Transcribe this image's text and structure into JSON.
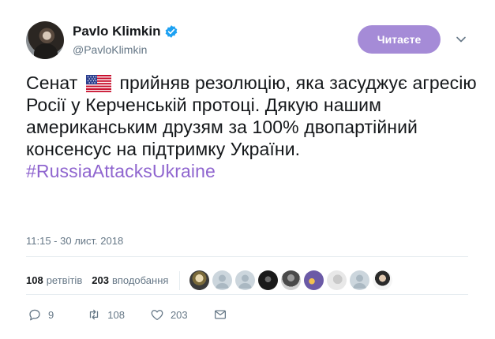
{
  "author": {
    "name": "Pavlo Klimkin",
    "handle": "@PavloKlimkin",
    "verified": true
  },
  "follow_button": {
    "label": "Читаєте"
  },
  "tweet": {
    "text_before_flag": "Сенат",
    "text_after_flag": "прийняв резолюцію, яка засуджує агресію Росії у Керченській протоці. Дякую нашим американським друзям за 100% двопартійний консенсус на підтримку України.",
    "hashtag": "#RussiaAttacksUkraine",
    "flag_icon": "us-flag-icon"
  },
  "timestamp": "11:15 - 30 лист. 2018",
  "stats": {
    "retweets_count": "108",
    "retweets_label": "ретвітів",
    "likes_count": "203",
    "likes_label": "вподобання"
  },
  "actions": {
    "reply_count": "9",
    "retweet_count": "108",
    "like_count": "203"
  },
  "colors": {
    "accent": "#a58bd7",
    "hashtag": "#8f65cf",
    "verified": "#1da1f2",
    "muted": "#657786"
  }
}
